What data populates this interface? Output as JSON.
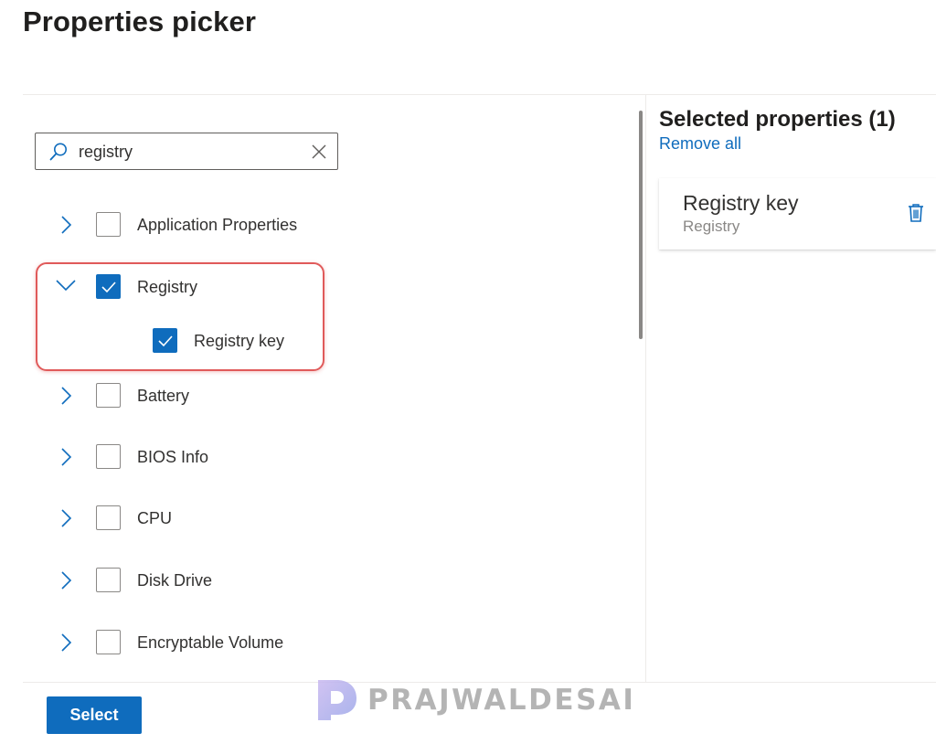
{
  "header": {
    "title": "Properties picker"
  },
  "search": {
    "value": "registry",
    "placeholder": "Search"
  },
  "tree": [
    {
      "label": "Application Properties",
      "checked": false,
      "expanded": false,
      "level": 0
    },
    {
      "label": "Registry",
      "checked": true,
      "expanded": true,
      "level": 0
    },
    {
      "label": "Registry key",
      "checked": true,
      "level": 1
    },
    {
      "label": "Battery",
      "checked": false,
      "expanded": false,
      "level": 0
    },
    {
      "label": "BIOS Info",
      "checked": false,
      "expanded": false,
      "level": 0
    },
    {
      "label": "CPU",
      "checked": false,
      "expanded": false,
      "level": 0
    },
    {
      "label": "Disk Drive",
      "checked": false,
      "expanded": false,
      "level": 0
    },
    {
      "label": "Encryptable Volume",
      "checked": false,
      "expanded": false,
      "level": 0
    }
  ],
  "selected_panel": {
    "title": "Selected properties (1)",
    "remove_all_label": "Remove all",
    "items": [
      {
        "name": "Registry key",
        "category": "Registry",
        "icon": "trash-icon"
      }
    ]
  },
  "footer": {
    "select_label": "Select"
  },
  "watermark": {
    "text": "PRAJWALDESAI"
  },
  "colors": {
    "accent": "#0f6cbd",
    "highlight": "#e05a5a",
    "text": "#323130",
    "subtext": "#8a8886"
  }
}
